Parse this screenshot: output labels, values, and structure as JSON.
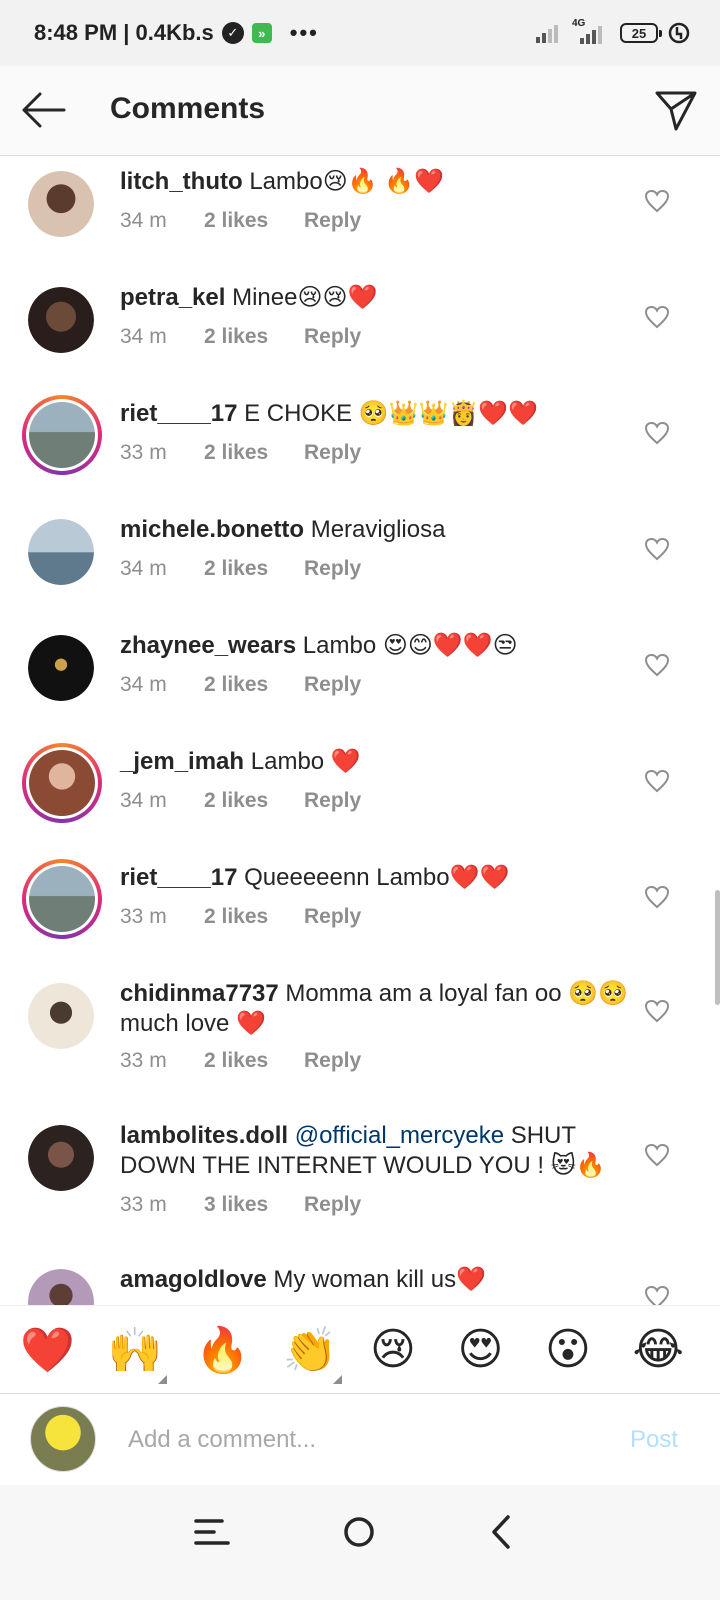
{
  "status_bar": {
    "time_speed": "8:48 PM | 0.4Kb.s",
    "network_label": "4G",
    "battery": "25",
    "icons": [
      "check-badge-icon",
      "app-notification-icon",
      "more-dots-icon",
      "signal-icon",
      "signal-4g-icon",
      "battery-icon",
      "sync-icon"
    ]
  },
  "header": {
    "title": "Comments",
    "back_icon": "arrow-left-icon",
    "send_icon": "direct-send-icon"
  },
  "comments": [
    {
      "username": "litch_thuto",
      "text": "Lambo😢🔥 🔥❤️",
      "time": "34 m",
      "likes": "2 likes",
      "reply": "Reply",
      "story_ring": false,
      "avatar_color": "#d9c3b0"
    },
    {
      "username": "petra_kel",
      "text": "Minee😢😢❤️",
      "time": "34 m",
      "likes": "2 likes",
      "reply": "Reply",
      "story_ring": false,
      "avatar_color": "#3a2a28"
    },
    {
      "username": "riet____17",
      "text": "E CHOKE 🥺👑👑👸❤️❤️",
      "time": "33 m",
      "likes": "2 likes",
      "reply": "Reply",
      "story_ring": true,
      "avatar_color": "#8aa0a8"
    },
    {
      "username": "michele.bonetto",
      "text": "Meravigliosa",
      "time": "34 m",
      "likes": "2 likes",
      "reply": "Reply",
      "story_ring": false,
      "avatar_color": "#9fb3c6"
    },
    {
      "username": "zhaynee_wears",
      "text": "Lambo 😍😊❤️❤️😒",
      "time": "34 m",
      "likes": "2 likes",
      "reply": "Reply",
      "story_ring": false,
      "avatar_color": "#1a1a1a"
    },
    {
      "username": "_jem_imah",
      "text": "Lambo ❤️",
      "time": "34 m",
      "likes": "2 likes",
      "reply": "Reply",
      "story_ring": true,
      "avatar_color": "#c98873"
    },
    {
      "username": "riet____17",
      "text": "Queeeeenn Lambo❤️❤️",
      "time": "33 m",
      "likes": "2 likes",
      "reply": "Reply",
      "story_ring": true,
      "avatar_color": "#8aa0a8"
    },
    {
      "username": "chidinma7737",
      "text": "Momma am a loyal fan oo 🥺🥺 much love ❤️",
      "time": "33 m",
      "likes": "2 likes",
      "reply": "Reply",
      "story_ring": false,
      "avatar_color": "#e8ddd0"
    },
    {
      "username": "lambolites.doll",
      "mention": "@official_mercyeke",
      "text": " SHUT DOWN THE INTERNET WOULD YOU ! 😻🔥",
      "time": "33 m",
      "likes": "3 likes",
      "reply": "Reply",
      "story_ring": false,
      "avatar_color": "#3b302c"
    },
    {
      "username": "amagoldlove",
      "text": "My woman kill us❤️",
      "time": "",
      "likes": "",
      "reply": "",
      "story_ring": false,
      "avatar_color": "#8a6f8f"
    }
  ],
  "emoji_bar": [
    "❤️",
    "🙌",
    "🔥",
    "👏",
    "😢",
    "😍",
    "😮",
    "😂"
  ],
  "input": {
    "placeholder": "Add a comment...",
    "post_label": "Post"
  },
  "nav_bar": {
    "icons": [
      "menu-icon",
      "home-circle-icon",
      "back-chevron-icon"
    ]
  },
  "colors": {
    "text": "#262626",
    "meta": "#8e8e8e",
    "mention": "#00376b",
    "post_disabled": "#b2dffc",
    "story_ring_start": "#f58529",
    "story_ring_end": "#8134af"
  }
}
